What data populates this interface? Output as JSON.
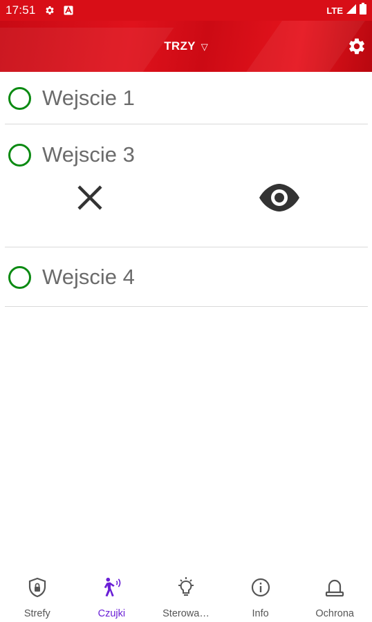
{
  "status_bar": {
    "time": "17:51",
    "icons": [
      "settings-icon",
      "a-icon"
    ],
    "network": "LTE",
    "right_icons": [
      "signal-icon",
      "battery-icon"
    ]
  },
  "app_bar": {
    "title": "TRZY",
    "dropdown_glyph": "▽",
    "settings_icon": "gear-icon",
    "color": "#d80e17"
  },
  "sensors": [
    {
      "label": "Wejscie 1",
      "status_color": "#0b8a12",
      "expanded": false
    },
    {
      "label": "Wejscie 3",
      "status_color": "#0b8a12",
      "expanded": true,
      "actions": [
        "close-icon",
        "eye-icon"
      ]
    },
    {
      "label": "Wejscie 4",
      "status_color": "#0b8a12",
      "expanded": false
    }
  ],
  "bottom_nav": {
    "active_color": "#6a1fd6",
    "items": [
      {
        "label": "Strefy",
        "icon": "shield-lock-icon",
        "active": false
      },
      {
        "label": "Czujki",
        "icon": "motion-sensor-icon",
        "active": true
      },
      {
        "label": "Sterowa…",
        "icon": "lightbulb-icon",
        "active": false
      },
      {
        "label": "Info",
        "icon": "info-icon",
        "active": false
      },
      {
        "label": "Ochrona",
        "icon": "alarm-icon",
        "active": false
      }
    ]
  }
}
